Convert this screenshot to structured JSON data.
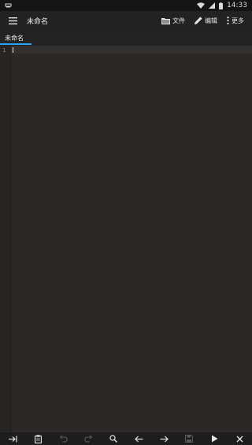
{
  "status_bar": {
    "time": "14:33",
    "icons": [
      "notification-icon",
      "wifi-icon",
      "signal-icon",
      "battery-icon"
    ]
  },
  "app_bar": {
    "title": "未命名",
    "menu_icon": "hamburger-menu-icon",
    "actions": [
      {
        "label": "文件",
        "icon": "folder-icon"
      },
      {
        "label": "编辑",
        "icon": "pencil-icon"
      },
      {
        "label": "更多",
        "icon": "more-vert-icon"
      }
    ]
  },
  "tabs": [
    {
      "label": "未命名",
      "active": true
    }
  ],
  "editor": {
    "line_numbers": [
      "1"
    ],
    "content": ""
  },
  "toolbar": {
    "buttons": [
      {
        "icon": "tab-indent-icon",
        "enabled": true
      },
      {
        "icon": "clipboard-icon",
        "enabled": true
      },
      {
        "icon": "undo-icon",
        "enabled": false
      },
      {
        "icon": "redo-icon",
        "enabled": false
      },
      {
        "icon": "search-icon",
        "enabled": true
      },
      {
        "icon": "arrow-left-icon",
        "enabled": true
      },
      {
        "icon": "arrow-right-icon",
        "enabled": true
      },
      {
        "icon": "save-icon",
        "enabled": false
      },
      {
        "icon": "play-icon",
        "enabled": true
      },
      {
        "icon": "close-icon",
        "enabled": true
      }
    ]
  },
  "colors": {
    "accent": "#2aa3ff",
    "editor_bg": "#2b2827",
    "app_bar_bg": "#222222"
  }
}
